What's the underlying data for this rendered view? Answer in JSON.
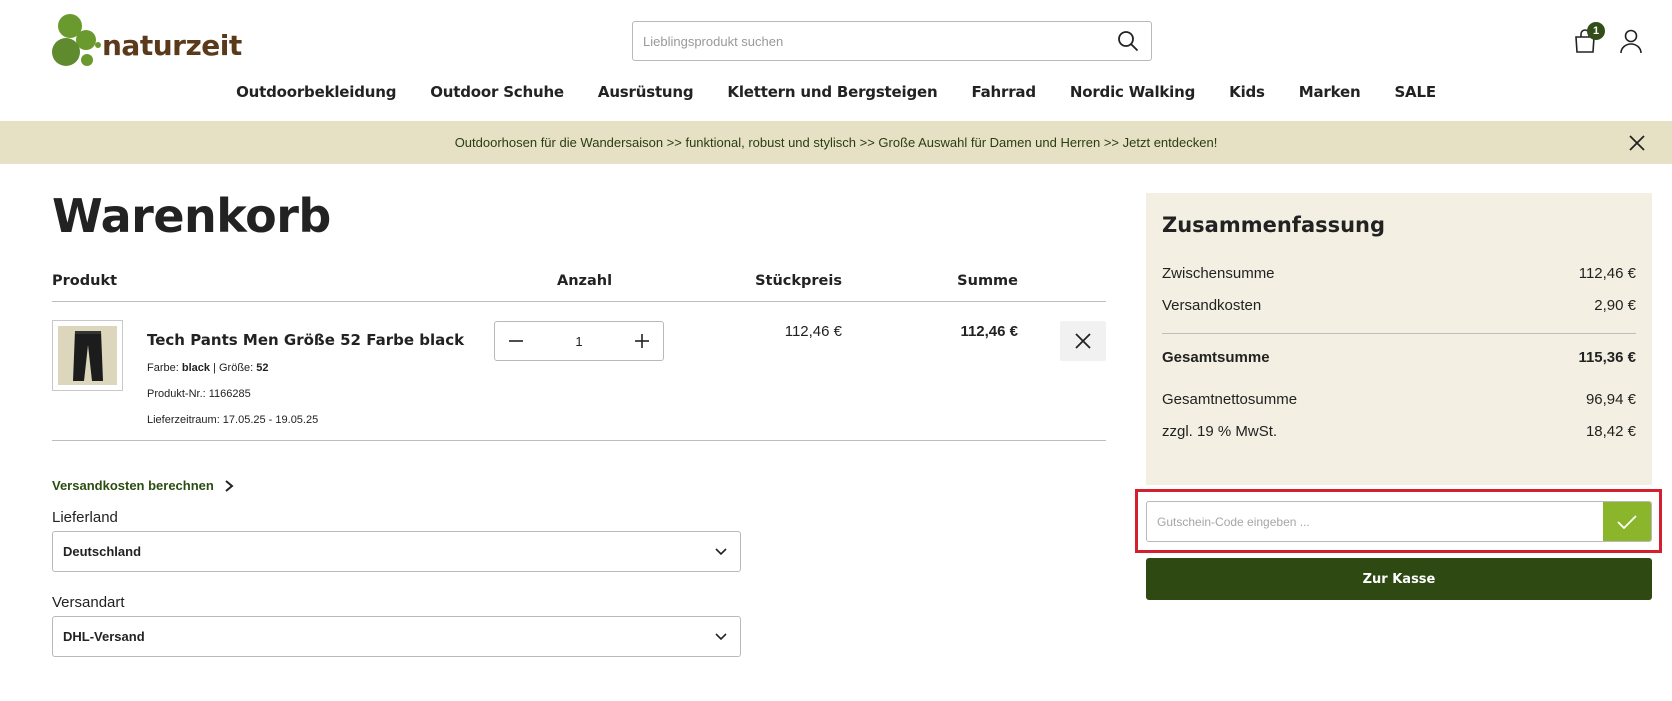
{
  "brand": {
    "name": "naturzeit",
    "logo_green": "#5f8a2e",
    "logo_brown": "#5a3a1a"
  },
  "search": {
    "placeholder": "Lieblingsprodukt suchen",
    "icon": "search-icon"
  },
  "header": {
    "cart_count": "1",
    "cart_icon": "shopping-bag-icon",
    "account_icon": "user-icon"
  },
  "nav": {
    "items": [
      "Outdoorbekleidung",
      "Outdoor Schuhe",
      "Ausrüstung",
      "Klettern und Bergsteigen",
      "Fahrrad",
      "Nordic Walking",
      "Kids",
      "Marken",
      "SALE"
    ]
  },
  "promo": {
    "text": "Outdoorhosen für die Wandersaison >> funktional, robust und stylisch >> Große Auswahl für Damen und Herren >> Jetzt entdecken!",
    "bg_color": "#e6e1c4"
  },
  "cart": {
    "title": "Warenkorb",
    "columns": {
      "product": "Produkt",
      "quantity": "Anzahl",
      "unit_price": "Stückpreis",
      "sum": "Summe"
    },
    "items": [
      {
        "name": "Tech Pants Men Größe 52 Farbe black",
        "color_label": "Farbe:",
        "color": "black",
        "separator": "|",
        "size_label": "Größe:",
        "size": "52",
        "sku_line": "Produkt-Nr.: 1166285",
        "delivery_line": "Lieferzeitraum: 17.05.25 - 19.05.25",
        "quantity": "1",
        "unit_price": "112,46 €",
        "total": "112,46 €"
      }
    ],
    "shipping_calc_label": "Versandkosten berechnen",
    "country_label": "Lieferland",
    "country_value": "Deutschland",
    "shipping_method_label": "Versandart",
    "shipping_method_value": "DHL-Versand"
  },
  "summary": {
    "title": "Zusammenfassung",
    "subtotal_label": "Zwischensumme",
    "subtotal": "112,46 €",
    "shipping_label": "Versandkosten",
    "shipping": "2,90 €",
    "total_label": "Gesamtsumme",
    "total": "115,36 €",
    "net_label": "Gesamtnettosumme",
    "net": "96,94 €",
    "vat_label": "zzgl. 19 % MwSt.",
    "vat": "18,42 €",
    "bg_color": "#f3f0e3"
  },
  "voucher": {
    "placeholder": "Gutschein-Code eingeben ...",
    "button_color": "#8bb62b",
    "highlight_color": "#d4202e"
  },
  "checkout": {
    "label": "Zur Kasse",
    "color": "#2e4a12"
  }
}
